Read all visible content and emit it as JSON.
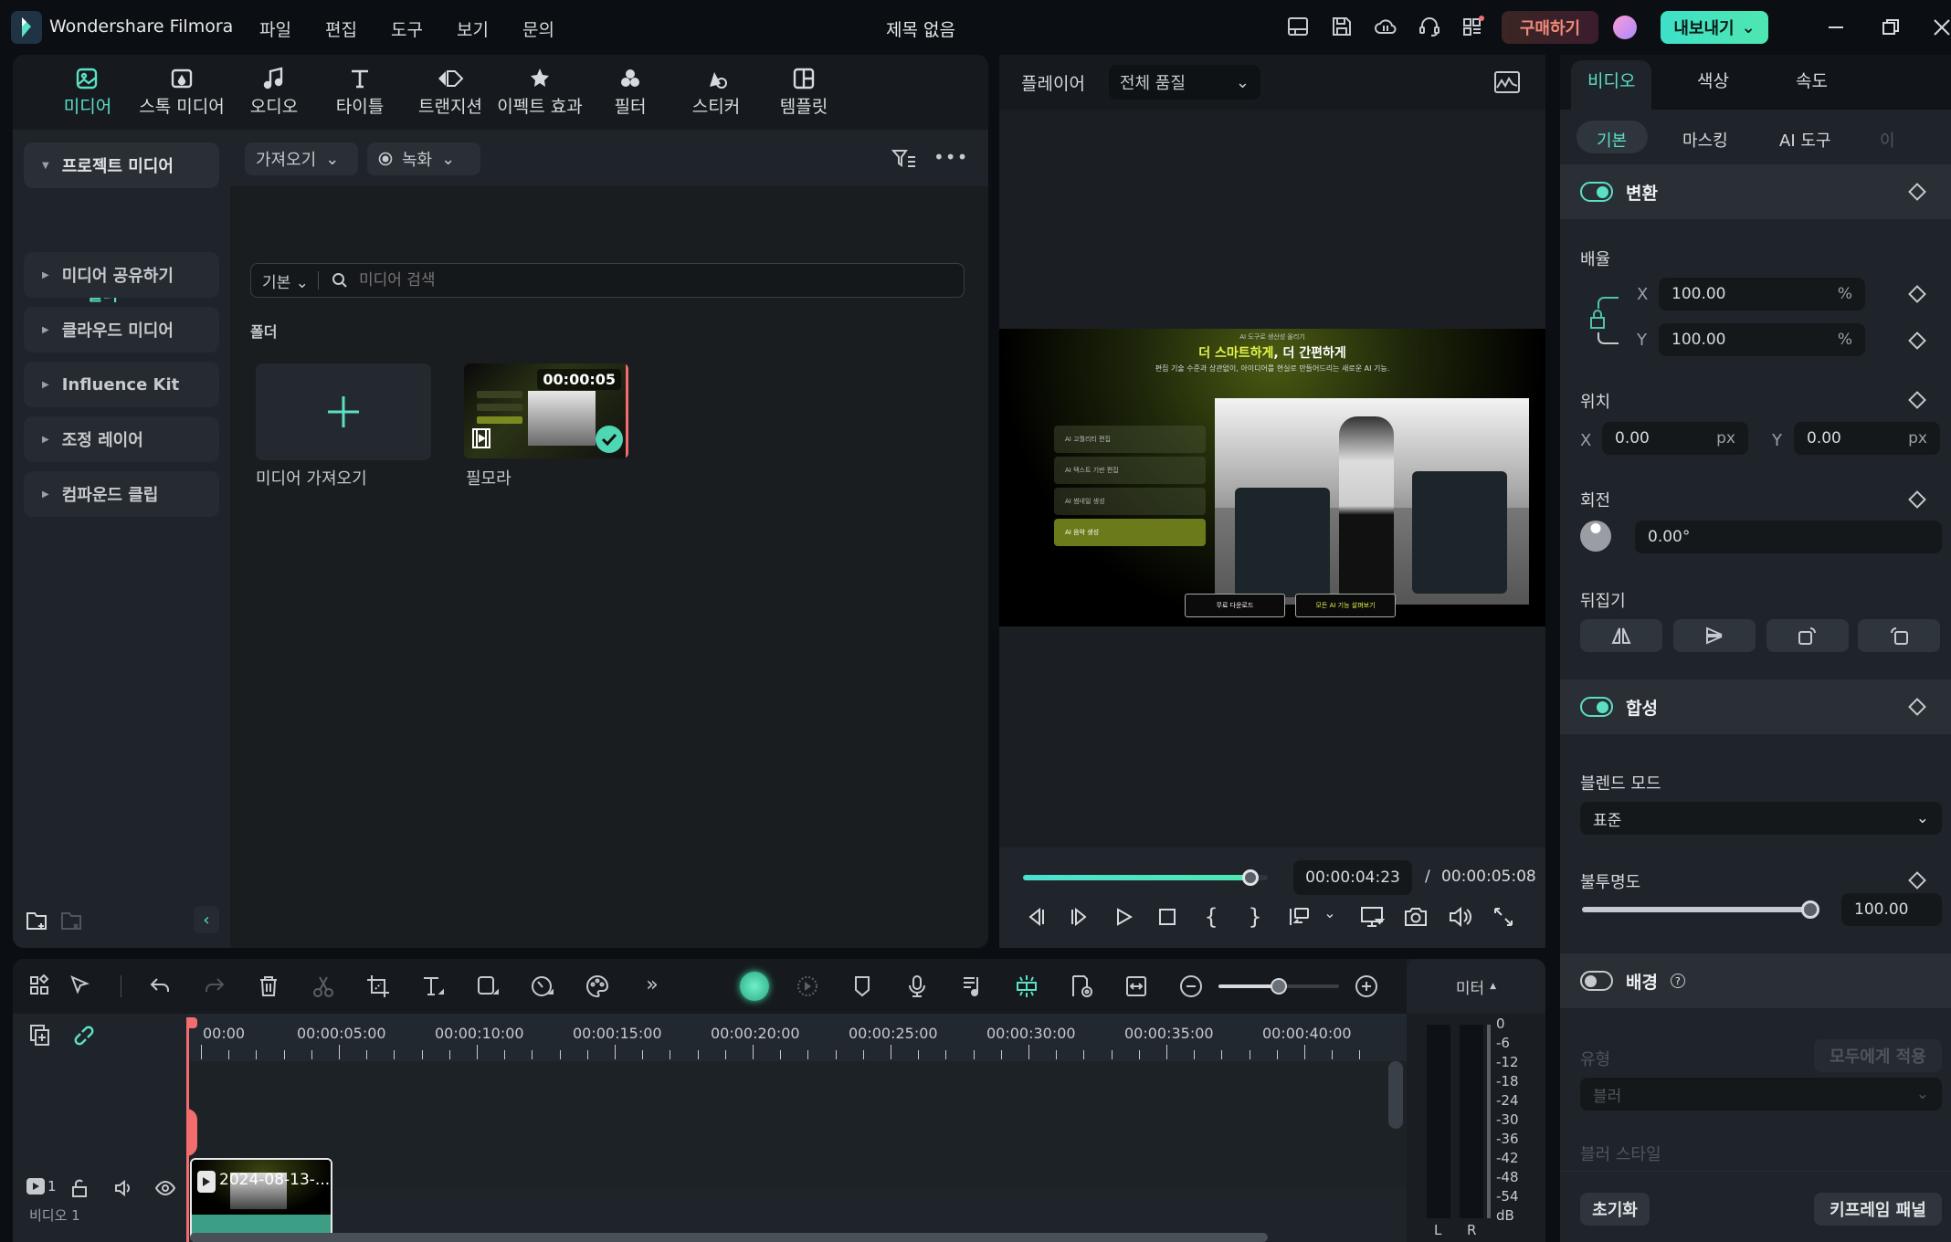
{
  "app": {
    "name": "Wondershare Filmora",
    "doc_title": "제목 없음"
  },
  "menu": [
    "파일",
    "편집",
    "도구",
    "보기",
    "문의"
  ],
  "titlebar": {
    "buy_label": "구매하기",
    "export_label": "내보내기"
  },
  "top_tabs": [
    {
      "label": "미디어",
      "icon": "media-icon",
      "active": true
    },
    {
      "label": "스톡 미디어",
      "icon": "stock-media-icon"
    },
    {
      "label": "오디오",
      "icon": "music-note-icon"
    },
    {
      "label": "타이틀",
      "icon": "text-icon"
    },
    {
      "label": "트랜지션",
      "icon": "transition-icon"
    },
    {
      "label": "이펙트 효과",
      "icon": "effects-icon"
    },
    {
      "label": "필터",
      "icon": "filter-icon"
    },
    {
      "label": "스티커",
      "icon": "sticker-icon"
    },
    {
      "label": "템플릿",
      "icon": "template-icon"
    }
  ],
  "sidebar": {
    "items": [
      {
        "label": "프로젝트 미디어",
        "expanded": true
      },
      {
        "label": "미디어 공유하기"
      },
      {
        "label": "클라우드 미디어"
      },
      {
        "label": "Influence Kit"
      },
      {
        "label": "조정 레이어"
      },
      {
        "label": "컴파운드 클립"
      }
    ],
    "sub_folder": "폴더"
  },
  "media": {
    "import_label": "가져오기",
    "record_label": "녹화",
    "view_mode": "기본",
    "search_placeholder": "미디어 검색",
    "section_label": "폴더",
    "tiles": [
      {
        "label": "미디어 가져오기",
        "type": "import"
      },
      {
        "label": "필모라",
        "duration": "00:00:05",
        "selected": true
      }
    ]
  },
  "player": {
    "label": "플레이어",
    "quality": "전체 품질",
    "current_time": "00:00:04:23",
    "total_time": "00:00:05:08",
    "progress": 0.93,
    "frame": {
      "eyebrow": "AI 도구로 생산성 올리기",
      "headline_highlight": "더 스마트하게",
      "headline_rest": ", 더 간편하게",
      "subtitle": "편집 기술 수준과 상관없이, 아이디어를 현실로 만들어드리는 새로운 AI 기능.",
      "features": [
        "AI 고퀄리티 편집",
        "AI 텍스트 기반 편집",
        "AI 썸네일 생성",
        "AI 음악 생성"
      ],
      "btn_download": "무료 다운로드",
      "btn_more": "모든 AI 기능 살펴보기"
    }
  },
  "properties": {
    "tabs": [
      "비디오",
      "색상",
      "속도"
    ],
    "subtabs": [
      "기본",
      "마스킹",
      "AI 도구",
      "이"
    ],
    "transform": {
      "title": "변환",
      "enabled": true,
      "scale_label": "배율",
      "scale_x": "100.00",
      "scale_y": "100.00",
      "scale_unit": "%",
      "position_label": "위치",
      "pos_x": "0.00",
      "pos_y": "0.00",
      "pos_unit": "px",
      "rotation_label": "회전",
      "rotation": "0.00°",
      "flip_label": "뒤집기"
    },
    "composite": {
      "title": "합성",
      "enabled": true,
      "blend_label": "블렌드 모드",
      "blend_value": "표준",
      "opacity_label": "불투명도",
      "opacity": "100.00",
      "opacity_fraction": 1.0
    },
    "background": {
      "title": "배경",
      "enabled": false,
      "type_label": "유형",
      "apply_all": "모두에게 적용",
      "type_value": "블러",
      "blur_style_label": "블러 스타일"
    },
    "reset_label": "초기화",
    "keyframe_label": "키프레임 패널"
  },
  "timeline": {
    "ticks": [
      "00:00",
      "00:00:05:00",
      "00:00:10:00",
      "00:00:15:00",
      "00:00:20:00",
      "00:00:25:00",
      "00:00:30:00",
      "00:00:35:00",
      "00:00:40:00"
    ],
    "track_label": "비디오 1",
    "track_index": "1",
    "clip_label": "2024-08-13-...",
    "zoom_fraction": 0.5,
    "meter_label": "미터",
    "meter_scale": [
      "0",
      "-6",
      "-12",
      "-18",
      "-24",
      "-30",
      "-36",
      "-42",
      "-48",
      "-54",
      "dB"
    ],
    "meter_channels": [
      "L",
      "R"
    ]
  },
  "colors": {
    "accent": "#5be0c4",
    "playhead": "#f26d6d"
  }
}
